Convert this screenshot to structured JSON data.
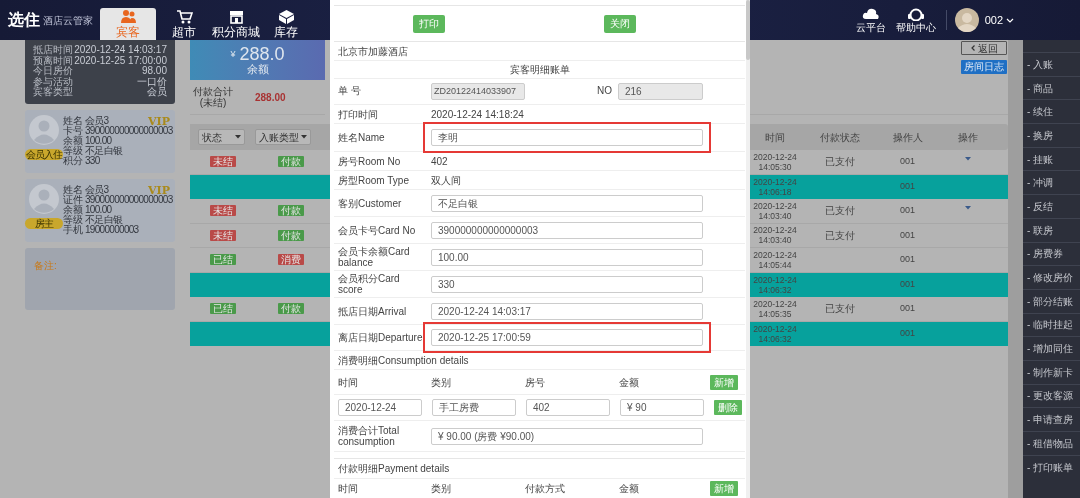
{
  "header": {
    "logo": {
      "name": "选住",
      "subtitle": "酒店云管家"
    },
    "tabs": [
      {
        "label": "宾客",
        "selected": true
      },
      {
        "label": "超市",
        "selected": false
      },
      {
        "label": "积分商城",
        "selected": false
      },
      {
        "label": "库存",
        "selected": false
      }
    ],
    "tools": [
      {
        "label": "云平台"
      },
      {
        "label": "帮助中心"
      }
    ],
    "user": "002"
  },
  "stay": [
    {
      "label": "抵店时间",
      "value": "2020-12-24 14:03:17"
    },
    {
      "label": "预离时间",
      "value": "2020-12-25 17:00:00"
    },
    {
      "label": "今日房价",
      "value": "98.00"
    },
    {
      "label": "参与活动",
      "value": "一口价"
    },
    {
      "label": "宾客类型",
      "value": "会员"
    }
  ],
  "guests": [
    {
      "badge": "会员入住",
      "vip": "VIP",
      "fields": [
        {
          "label": "姓名",
          "value": "会员3"
        },
        {
          "label": "卡号",
          "value": "390000000000000003"
        },
        {
          "label": "余额",
          "value": "100.00"
        },
        {
          "label": "等级",
          "value": "不足白银"
        },
        {
          "label": "积分",
          "value": "330"
        }
      ]
    },
    {
      "badge": "房主",
      "vip": "VIP",
      "fields": [
        {
          "label": "姓名",
          "value": "会员3"
        },
        {
          "label": "证件",
          "value": "390000000000000003"
        },
        {
          "label": "余额",
          "value": "100.00"
        },
        {
          "label": "等级",
          "value": "不足白银"
        },
        {
          "label": "手机",
          "value": "19000000003"
        }
      ]
    }
  ],
  "remark": "备注:",
  "balance": {
    "currency": "¥",
    "amount": "288.0",
    "label": "余额"
  },
  "payment_total": {
    "label": "付款合计\n(未结)",
    "value": "288.00"
  },
  "filters": [
    {
      "label": "状态"
    },
    {
      "label": "入账类型"
    }
  ],
  "actions": {
    "back": "返回",
    "room_log": "房间日志"
  },
  "table": {
    "columns": [
      "时间",
      "付款状态",
      "操作人",
      "操作"
    ],
    "rows": [
      {
        "highlighted": false,
        "badges": [
          {
            "label": "未结",
            "color": "#b94a48"
          },
          {
            "label": "付款",
            "color": "#4a9a4a"
          }
        ],
        "time": "2020-12-24 14:05:30",
        "pay_status": "已支付",
        "operator": "001",
        "menu": true
      },
      {
        "highlighted": true,
        "badges": [],
        "time": "2020-12-24 14:06:18",
        "pay_status": "",
        "operator": "001",
        "menu": false
      },
      {
        "highlighted": false,
        "badges": [
          {
            "label": "未结",
            "color": "#b94a48"
          },
          {
            "label": "付款",
            "color": "#4a9a4a"
          }
        ],
        "time": "2020-12-24 14:03:40",
        "pay_status": "已支付",
        "operator": "001",
        "menu": true
      },
      {
        "highlighted": false,
        "badges": [
          {
            "label": "未结",
            "color": "#b94a48"
          },
          {
            "label": "付款",
            "color": "#4a9a4a"
          }
        ],
        "time": "2020-12-24 14:03:40",
        "pay_status": "已支付",
        "operator": "001",
        "menu": false
      },
      {
        "highlighted": false,
        "badges": [
          {
            "label": "已结",
            "color": "#4a9a4a"
          },
          {
            "label": "消费",
            "color": "#b94a48"
          }
        ],
        "time": "2020-12-24 14:05:44",
        "pay_status": "",
        "operator": "001",
        "menu": false
      },
      {
        "highlighted": true,
        "badges": [],
        "time": "2020-12-24 14:06:32",
        "pay_status": "",
        "operator": "001",
        "menu": false
      },
      {
        "highlighted": false,
        "badges": [
          {
            "label": "已结",
            "color": "#4a9a4a"
          },
          {
            "label": "付款",
            "color": "#4a9a4a"
          }
        ],
        "time": "2020-12-24 14:05:35",
        "pay_status": "已支付",
        "operator": "001",
        "menu": false
      },
      {
        "highlighted": true,
        "badges": [],
        "time": "2020-12-24 14:06:32",
        "pay_status": "",
        "operator": "001",
        "menu": false
      }
    ]
  },
  "sidebar": [
    "- 入账",
    "- 商品",
    "- 续住",
    "- 换房",
    "- 挂账",
    "- 冲调",
    "- 反结",
    "- 联房",
    "- 房费券",
    "- 修改房价",
    "- 部分结账",
    "- 临时挂起",
    "- 增加同住",
    "- 制作新卡",
    "- 更改客源",
    "- 申请查房",
    "- 租借物品",
    "- 打印账单"
  ],
  "modal": {
    "buttons": [
      "打印",
      "关闭"
    ],
    "hotel": "北京市加藤酒店",
    "title": "宾客明细账单",
    "bill_no": {
      "label": "单 号",
      "value": "ZD20122414033907",
      "disabled": true
    },
    "no": {
      "label": "NO",
      "value": "216",
      "disabled": true
    },
    "fields": [
      {
        "kind": "text",
        "label": "打印时间",
        "value": "2020-12-24 14:18:24",
        "highlighted": false
      },
      {
        "kind": "input",
        "label": "姓名Name",
        "value": "李明",
        "highlighted": true
      },
      {
        "kind": "text",
        "label": "房号Room No",
        "value": "402",
        "highlighted": false
      },
      {
        "kind": "text",
        "label": "房型Room Type",
        "value": "双人间",
        "highlighted": false
      },
      {
        "kind": "input",
        "label": "客别Customer",
        "value": "不足白银",
        "highlighted": false
      },
      {
        "kind": "input",
        "label": "会员卡号Card No",
        "value": "390000000000000003",
        "highlighted": false
      },
      {
        "kind": "input",
        "label": "会员卡余额Card balance",
        "value": "100.00",
        "highlighted": false
      },
      {
        "kind": "input",
        "label": "会员积分Card score",
        "value": "330",
        "highlighted": false
      },
      {
        "kind": "input",
        "label": "抵店日期Arrival",
        "value": "2020-12-24 14:03:17",
        "highlighted": false
      },
      {
        "kind": "input",
        "label": "离店日期Departure",
        "value": "2020-12-25 17:00:59",
        "highlighted": true
      }
    ],
    "consumption": {
      "title": "消费明细Consumption details",
      "columns": [
        "时间",
        "类别",
        "房号",
        "金额"
      ],
      "add": "新增",
      "rows": [
        {
          "values": [
            "2020-12-24",
            "手工房费",
            "402",
            "¥ 90"
          ],
          "action": "删除"
        }
      ],
      "total": {
        "label": "消费合计Total consumption",
        "value": "¥ 90.00 (房费 ¥90.00)"
      }
    },
    "payment": {
      "title": "付款明细Payment details",
      "columns": [
        "时间",
        "类别",
        "付款方式",
        "金额"
      ],
      "add": "新增"
    }
  }
}
